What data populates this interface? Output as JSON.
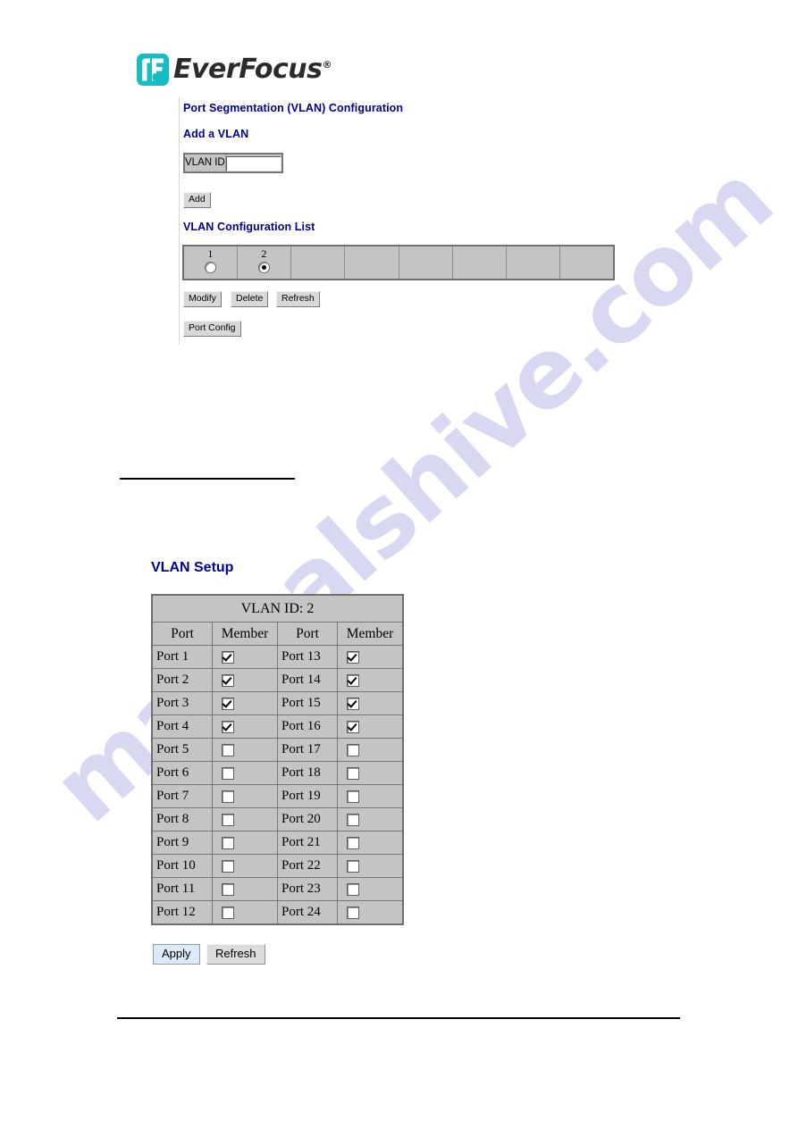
{
  "brand": {
    "name": "EverFocus",
    "registered_mark": "®",
    "logo_color": "#17bdc4"
  },
  "watermark": {
    "text": "manualshive.com",
    "color": "#b9b9ea"
  },
  "vlan_config_page": {
    "page_title": "Port Segmentation (VLAN) Configuration",
    "add_section_title": "Add a VLAN",
    "vlan_id_label": "VLAN ID",
    "vlan_id_value": "",
    "vlan_id_placeholder": "",
    "add_button": "Add",
    "list_section_title": "VLAN Configuration List",
    "list_cells": [
      {
        "label": "1",
        "selected": false
      },
      {
        "label": "2",
        "selected": true
      },
      {
        "label": "",
        "selected": null
      },
      {
        "label": "",
        "selected": null
      },
      {
        "label": "",
        "selected": null
      },
      {
        "label": "",
        "selected": null
      },
      {
        "label": "",
        "selected": null
      },
      {
        "label": "",
        "selected": null
      }
    ],
    "modify_button": "Modify",
    "delete_button": "Delete",
    "refresh_button": "Refresh",
    "port_config_button": "Port Config"
  },
  "vlan_setup_page": {
    "section_title": "VLAN Setup",
    "table_caption": "VLAN ID: 2",
    "columns": [
      "Port",
      "Member",
      "Port",
      "Member"
    ],
    "rows": [
      {
        "left_port": "Port 1",
        "left_member": true,
        "right_port": "Port 13",
        "right_member": true
      },
      {
        "left_port": "Port 2",
        "left_member": true,
        "right_port": "Port 14",
        "right_member": true
      },
      {
        "left_port": "Port 3",
        "left_member": true,
        "right_port": "Port 15",
        "right_member": true
      },
      {
        "left_port": "Port 4",
        "left_member": true,
        "right_port": "Port 16",
        "right_member": true
      },
      {
        "left_port": "Port 5",
        "left_member": false,
        "right_port": "Port 17",
        "right_member": false
      },
      {
        "left_port": "Port 6",
        "left_member": false,
        "right_port": "Port 18",
        "right_member": false
      },
      {
        "left_port": "Port 7",
        "left_member": false,
        "right_port": "Port 19",
        "right_member": false
      },
      {
        "left_port": "Port 8",
        "left_member": false,
        "right_port": "Port 20",
        "right_member": false
      },
      {
        "left_port": "Port 9",
        "left_member": false,
        "right_port": "Port 21",
        "right_member": false
      },
      {
        "left_port": "Port 10",
        "left_member": false,
        "right_port": "Port 22",
        "right_member": false
      },
      {
        "left_port": "Port 11",
        "left_member": false,
        "right_port": "Port 23",
        "right_member": false
      },
      {
        "left_port": "Port 12",
        "left_member": false,
        "right_port": "Port 24",
        "right_member": false
      }
    ],
    "apply_button": "Apply",
    "refresh_button": "Refresh"
  }
}
